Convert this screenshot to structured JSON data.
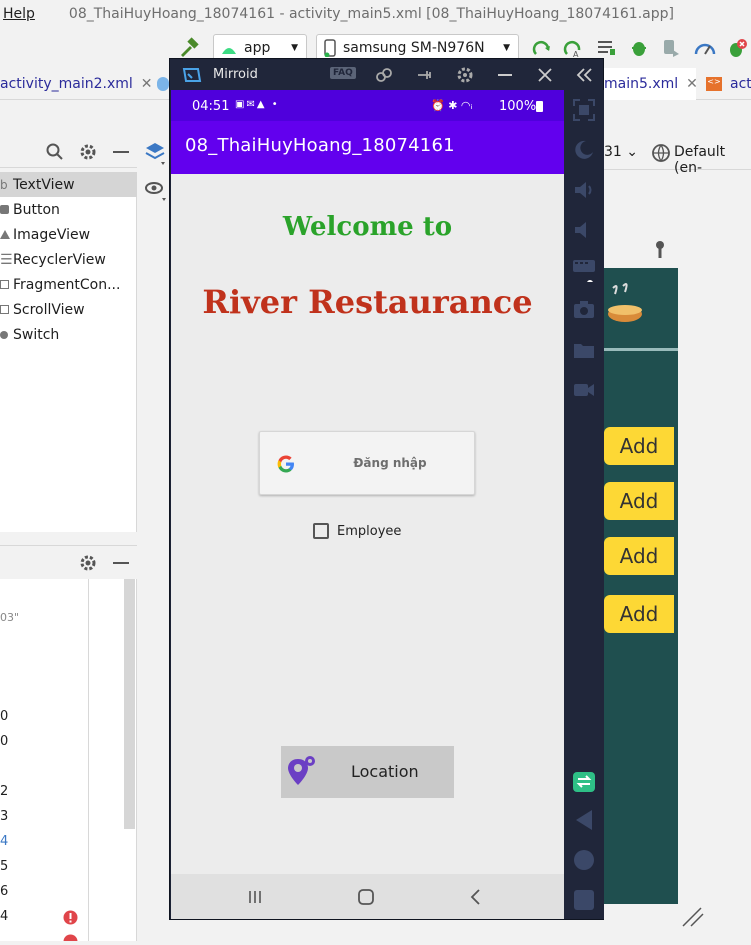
{
  "ide": {
    "menu_help": "Help",
    "title": "08_ThaiHuyHoang_18074161 - activity_main5.xml [08_ThaiHuyHoang_18074161.app]",
    "run_config": "app",
    "device": "samsung SM-N976N",
    "tab_left": "activity_main2.xml",
    "tab_right_a": "main5.xml",
    "tab_right_b": "act",
    "api_level": "31",
    "locale": "Default (en-",
    "palette": [
      {
        "label": "TextView",
        "icon": "textview-icon",
        "selected": true
      },
      {
        "label": "Button",
        "icon": "button-icon"
      },
      {
        "label": "ImageView",
        "icon": "imageview-icon"
      },
      {
        "label": "RecyclerView",
        "icon": "list-icon"
      },
      {
        "label": "FragmentCon...",
        "icon": "fragment-icon"
      },
      {
        "label": "ScrollView",
        "icon": "scrollview-icon"
      },
      {
        "label": "Switch",
        "icon": "switch-icon"
      }
    ],
    "tree_fragment": "03\"",
    "gutter_numbers": [
      "0",
      "0",
      "2",
      "3",
      "4",
      "5",
      "6",
      "4"
    ],
    "add_buttons": [
      "Add",
      "Add",
      "Add",
      "Add"
    ],
    "colors": {
      "blueprint": "#1f4f4f",
      "add_button": "#fdd835",
      "error": "#e0454a"
    }
  },
  "mirroid": {
    "title": "Mirroid",
    "faq": "FAQ"
  },
  "phone": {
    "time": "04:51",
    "battery": "100%",
    "app_title": "08_ThaiHuyHoang_18074161",
    "welcome": "Welcome to",
    "restaurant": "River Restaurance",
    "google_signin": "Đăng nhập",
    "employee_label": "Employee",
    "employee_checked": false,
    "location_button": "Location",
    "colors": {
      "status_bar": "#4f00dc",
      "app_bar": "#6200ee",
      "welcome": "#2aa32a",
      "restaurant": "#c0321c"
    }
  }
}
